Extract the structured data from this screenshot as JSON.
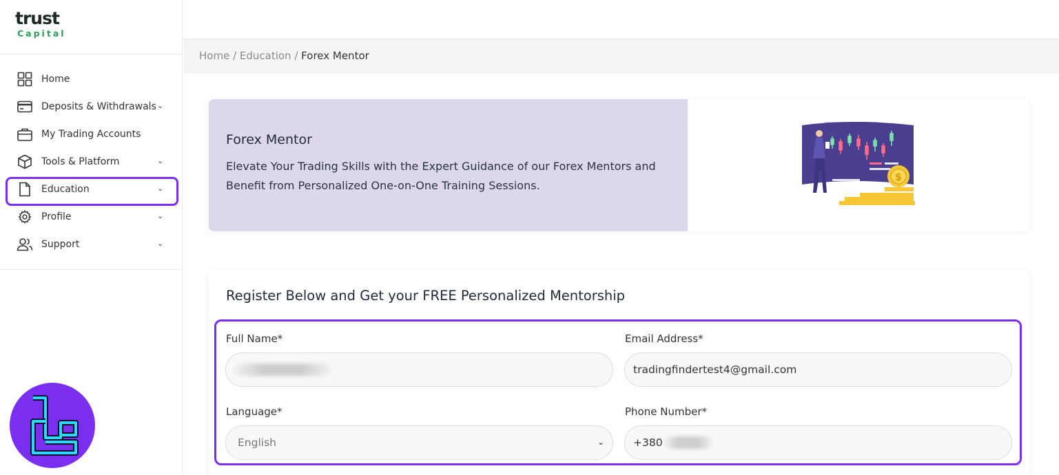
{
  "brand": {
    "logo_top": "trust",
    "logo_bottom": "Capital"
  },
  "sidebar": {
    "items": [
      {
        "label": "Home",
        "icon": "grid-icon",
        "has_chevron": false
      },
      {
        "label": "Deposits & Withdrawals",
        "icon": "credit-card-icon",
        "has_chevron": true
      },
      {
        "label": "My Trading Accounts",
        "icon": "briefcase-icon",
        "has_chevron": false
      },
      {
        "label": "Tools & Platform",
        "icon": "box-icon",
        "has_chevron": true
      },
      {
        "label": "Education",
        "icon": "document-icon",
        "has_chevron": true,
        "active": true
      },
      {
        "label": "Profile",
        "icon": "gear-icon",
        "has_chevron": true
      },
      {
        "label": "Support",
        "icon": "users-icon",
        "has_chevron": true
      }
    ]
  },
  "breadcrumb": {
    "home": "Home",
    "sep1": " / ",
    "section": "Education",
    "sep2": " / ",
    "current": "Forex Mentor"
  },
  "banner": {
    "title": "Forex Mentor",
    "description": "Elevate Your Trading Skills with the Expert Guidance of our Forex Mentors and Benefit from Personalized One-on-One Training Sessions."
  },
  "register": {
    "title": "Register Below and Get your FREE Personalized Mentorship",
    "full_name_label": "Full Name*",
    "email_label": "Email Address*",
    "email_value": "tradingfindertest4@gmail.com",
    "language_label": "Language*",
    "language_value": "English",
    "phone_label": "Phone Number*",
    "phone_prefix": "+380"
  },
  "colors": {
    "accent": "#7a2ff0",
    "banner_bg": "#dcd7ea",
    "brand_green": "#2c9b5a"
  }
}
